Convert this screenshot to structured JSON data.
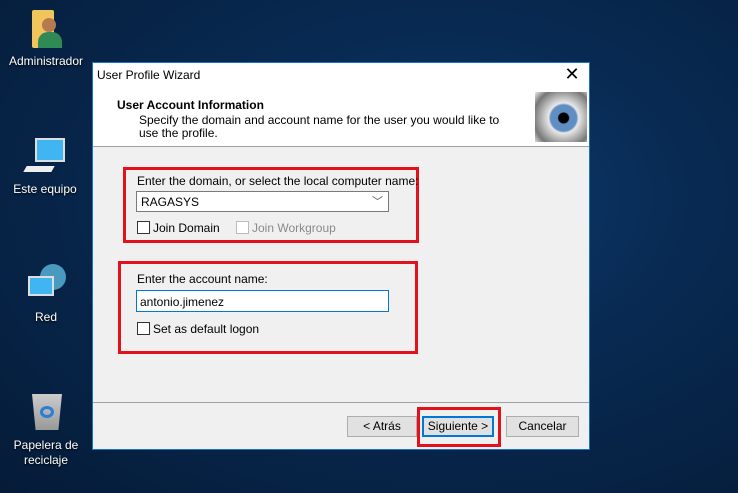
{
  "desktop": {
    "icons": [
      {
        "label": "Administrador",
        "icon": "user-folder-icon"
      },
      {
        "label": "Este equipo",
        "icon": "computer-icon"
      },
      {
        "label": "Red",
        "icon": "network-icon"
      },
      {
        "label": "Papelera de reciclaje",
        "icon": "recycle-bin-icon"
      }
    ]
  },
  "dialog": {
    "title": "User Profile Wizard",
    "header_title": "User Account Information",
    "header_desc": "Specify the domain and account name for the user you would like to use the profile.",
    "domain_label": "Enter the domain, or select the local computer name:",
    "domain_value": "RAGASYS",
    "join_domain": "Join Domain",
    "join_workgroup": "Join Workgroup",
    "account_label": "Enter the account name:",
    "account_value": "antonio.jimenez",
    "default_logon": "Set as default logon",
    "back": "< Atrás",
    "next": "Siguiente >",
    "cancel": "Cancelar"
  },
  "colors": {
    "highlight": "#e3111b",
    "focus": "#0078d7"
  }
}
